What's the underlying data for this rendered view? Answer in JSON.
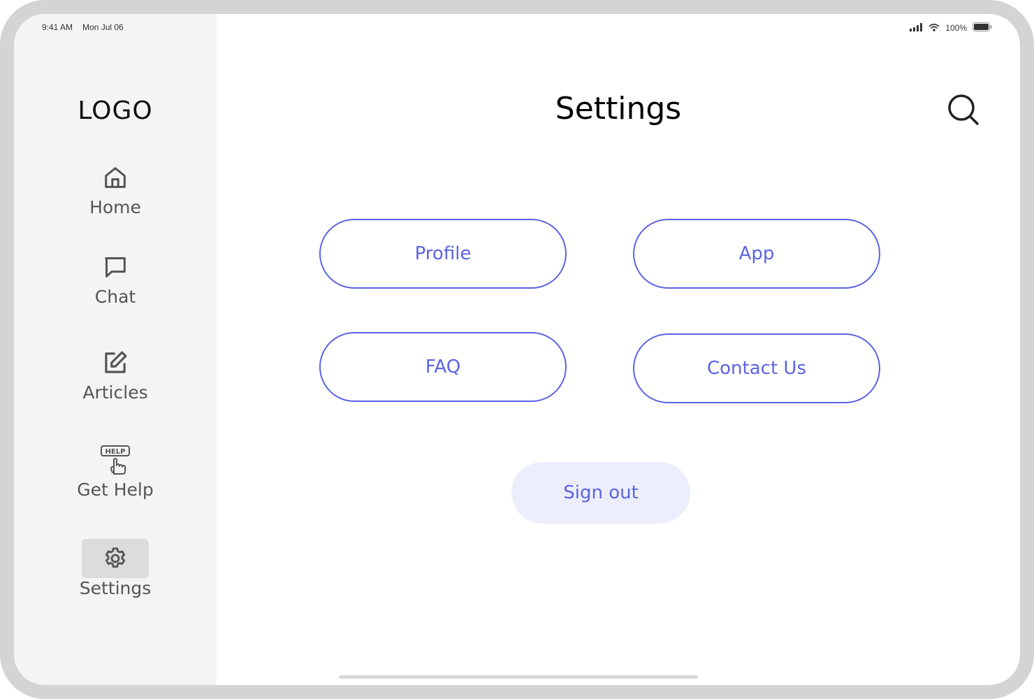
{
  "status_bar": {
    "time": "9:41 AM",
    "date": "Mon Jul 06",
    "battery": "100%"
  },
  "sidebar": {
    "logo": "LOGO",
    "items": [
      {
        "label": "Home",
        "icon": "home-icon"
      },
      {
        "label": "Chat",
        "icon": "chat-bubble-icon"
      },
      {
        "label": "Articles",
        "icon": "edit-note-icon"
      },
      {
        "label": "Get Help",
        "icon": "help-sign-icon"
      },
      {
        "label": "Settings",
        "icon": "gear-icon",
        "active": true
      }
    ]
  },
  "header": {
    "title": "Settings",
    "search_icon": "search-icon"
  },
  "main": {
    "options": [
      {
        "label": "Profile"
      },
      {
        "label": "App"
      },
      {
        "label": "FAQ"
      },
      {
        "label": "Contact Us"
      }
    ],
    "sign_out_label": "Sign out"
  },
  "colors": {
    "accent": "#5b63e3",
    "accent_soft": "#eceefb",
    "sidebar_bg": "#f4f4f4",
    "active_item_bg": "#dcdcdc",
    "frame": "#d4d4d4"
  }
}
